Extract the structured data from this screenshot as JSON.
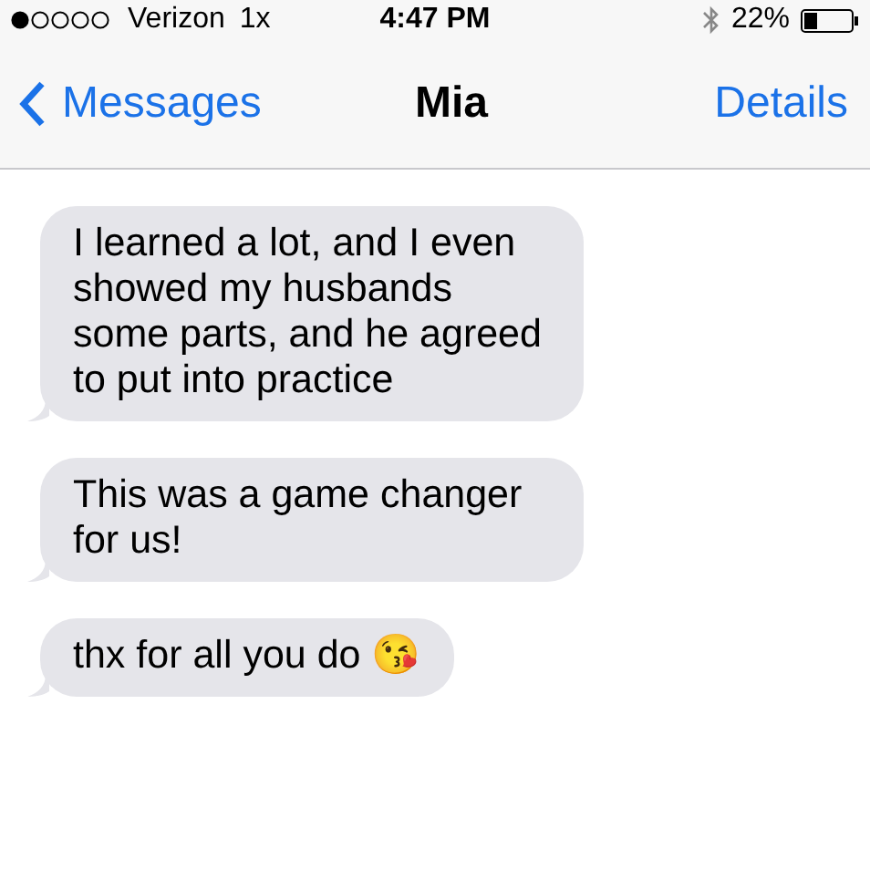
{
  "status_bar": {
    "carrier": "Verizon",
    "network": "1x",
    "time": "4:47 PM",
    "battery": "22%"
  },
  "nav": {
    "back": "Messages",
    "title": "Mia",
    "action": "Details"
  },
  "messages": [
    {
      "text": "I learned a lot, and I even showed my husbands some parts, and he agreed to put into practice"
    },
    {
      "text": "This was a game changer for us!"
    },
    {
      "text": "thx for all you do 😘"
    }
  ]
}
